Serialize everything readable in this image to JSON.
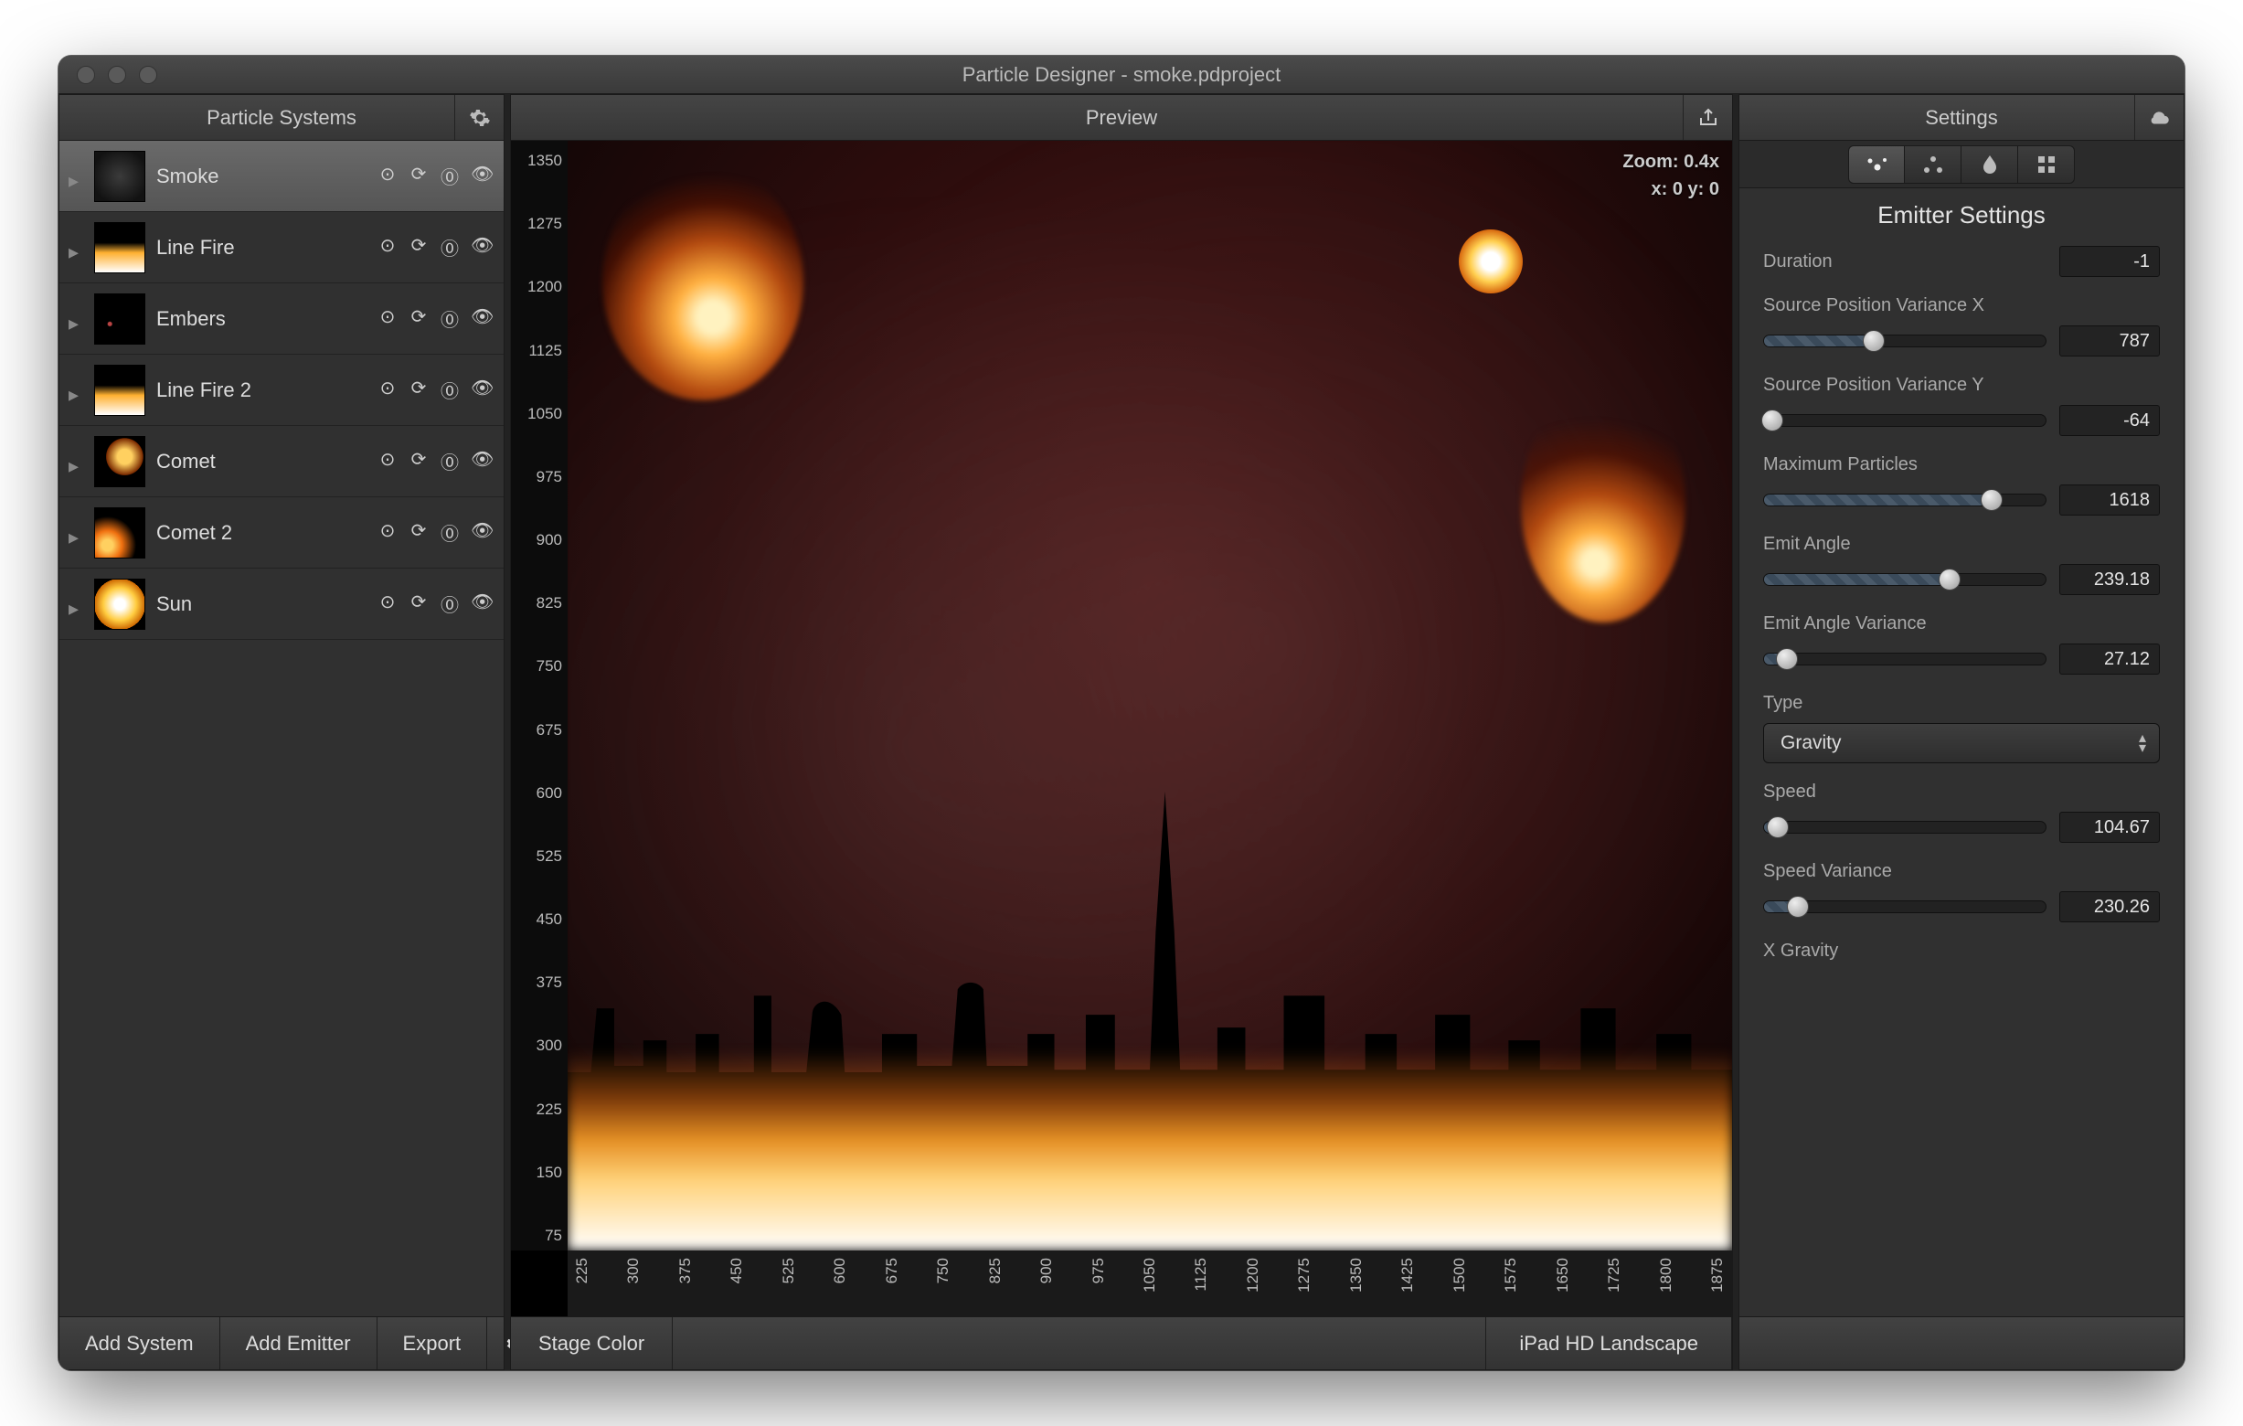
{
  "window": {
    "title": "Particle Designer - smoke.pdproject"
  },
  "sidebar": {
    "title": "Particle Systems",
    "items": [
      {
        "name": "Smoke",
        "thumb": "smoke",
        "selected": true
      },
      {
        "name": "Line Fire",
        "thumb": "linefire",
        "selected": false
      },
      {
        "name": "Embers",
        "thumb": "embers",
        "selected": false
      },
      {
        "name": "Line Fire 2",
        "thumb": "linefire",
        "selected": false
      },
      {
        "name": "Comet",
        "thumb": "comet",
        "selected": false
      },
      {
        "name": "Comet 2",
        "thumb": "comet2",
        "selected": false
      },
      {
        "name": "Sun",
        "thumb": "sun",
        "selected": false
      }
    ],
    "footer": {
      "add_system": "Add System",
      "add_emitter": "Add Emitter",
      "export": "Export"
    }
  },
  "preview": {
    "title": "Preview",
    "zoom_label": "Zoom: 0.4x",
    "coords_label": "x: 0 y: 0",
    "ruler_y": [
      "1350",
      "1275",
      "1200",
      "1125",
      "1050",
      "975",
      "900",
      "825",
      "750",
      "675",
      "600",
      "525",
      "450",
      "375",
      "300",
      "225",
      "150",
      "75"
    ],
    "ruler_x": [
      "225",
      "300",
      "375",
      "450",
      "525",
      "600",
      "675",
      "750",
      "825",
      "900",
      "975",
      "1050",
      "1125",
      "1200",
      "1275",
      "1350",
      "1425",
      "1500",
      "1575",
      "1650",
      "1725",
      "1800",
      "1875"
    ],
    "footer": {
      "stage_color": "Stage Color",
      "device": "iPad HD Landscape"
    }
  },
  "settings": {
    "title": "Settings",
    "section_title": "Emitter Settings",
    "tabs": [
      "emitter",
      "behavior",
      "color",
      "texture"
    ],
    "active_tab": 0,
    "fields": {
      "duration": {
        "label": "Duration",
        "value": "-1",
        "pct": null
      },
      "src_var_x": {
        "label": "Source Position Variance X",
        "value": "787",
        "pct": 39
      },
      "src_var_y": {
        "label": "Source Position Variance Y",
        "value": "-64",
        "pct": 3
      },
      "max_particles": {
        "label": "Maximum Particles",
        "value": "1618",
        "pct": 81
      },
      "emit_angle": {
        "label": "Emit Angle",
        "value": "239.18",
        "pct": 66
      },
      "emit_angle_var": {
        "label": "Emit Angle Variance",
        "value": "27.12",
        "pct": 8
      },
      "type": {
        "label": "Type",
        "value": "Gravity"
      },
      "speed": {
        "label": "Speed",
        "value": "104.67",
        "pct": 5
      },
      "speed_var": {
        "label": "Speed Variance",
        "value": "230.26",
        "pct": 12
      },
      "x_gravity": {
        "label": "X Gravity"
      }
    }
  }
}
